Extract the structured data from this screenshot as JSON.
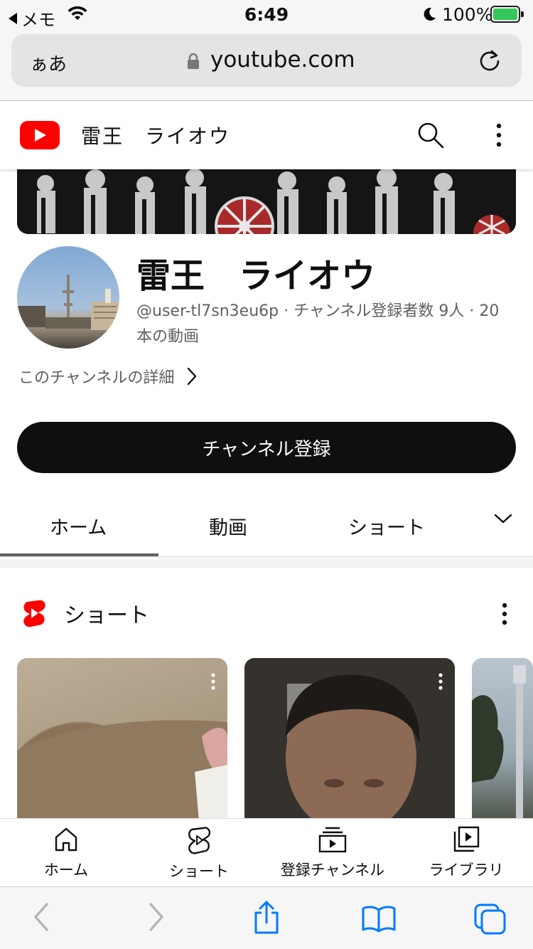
{
  "status_bar": {
    "back_app": "メモ",
    "time": "6:49",
    "battery": "100%"
  },
  "safari": {
    "text_size_button": "ぁあ",
    "url": "youtube.com"
  },
  "header": {
    "channel_title": "雷王　ライオウ"
  },
  "channel": {
    "name": "雷王　ライオウ",
    "meta": "@user-tl7sn3eu6p · チャンネル登録者数 9人 · 20 本の動画",
    "details_link": "このチャンネルの詳細",
    "subscribe_label": "チャンネル登録"
  },
  "tabs": {
    "home": "ホーム",
    "videos": "動画",
    "shorts": "ショート"
  },
  "shorts_shelf": {
    "title": "ショート"
  },
  "bottom_nav": {
    "home": "ホーム",
    "shorts": "ショート",
    "subscriptions": "登録チャンネル",
    "library": "ライブラリ"
  },
  "colors": {
    "youtube_red": "#ff0000",
    "accent_ios_blue": "#007aff",
    "battery_green": "#34c759"
  },
  "icons": [
    "wifi-icon",
    "moon-icon",
    "lock-icon",
    "reload-icon",
    "search-icon",
    "more-vert-icon",
    "chevron-right-icon",
    "chevron-down-icon",
    "shorts-logo-icon",
    "home-icon",
    "shorts-icon",
    "subscriptions-icon",
    "library-icon",
    "back-icon",
    "forward-icon",
    "share-icon",
    "bookmarks-icon",
    "tabs-icon"
  ]
}
